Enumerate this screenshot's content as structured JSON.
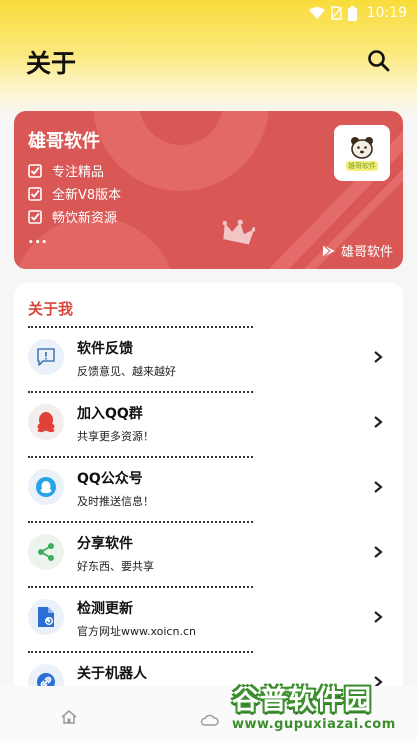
{
  "status_bar": {
    "time": "10:19"
  },
  "header": {
    "title": "关于"
  },
  "banner": {
    "title": "雄哥软件",
    "features": [
      "专注精品",
      "全新V8版本",
      "畅饮新资源"
    ],
    "more": "...",
    "logo_text": "雄哥软件",
    "brand": "雄哥软件",
    "bg_color": "#d95856"
  },
  "about": {
    "section_title": "关于我",
    "accent_color": "#d9473f",
    "items": [
      {
        "title": "软件反馈",
        "subtitle": "反馈意见、越来越好",
        "icon": "feedback-icon"
      },
      {
        "title": "加入QQ群",
        "subtitle": "共享更多资源！",
        "icon": "qq-penguin-icon"
      },
      {
        "title": "QQ公众号",
        "subtitle": "及时推送信息！",
        "icon": "qq-official-icon"
      },
      {
        "title": "分享软件",
        "subtitle": "好东西、要共享",
        "icon": "share-icon"
      },
      {
        "title": "检测更新",
        "subtitle": "官方网址www.xoicn.cn",
        "icon": "update-file-icon"
      },
      {
        "title": "关于机器人",
        "subtitle": "",
        "icon": "link-icon"
      }
    ]
  },
  "bottom_nav": {
    "items": [
      "home-icon",
      "cloud-icon"
    ]
  },
  "watermark": {
    "big": "谷普软件园",
    "small": "www.gupuxiazai.com"
  }
}
